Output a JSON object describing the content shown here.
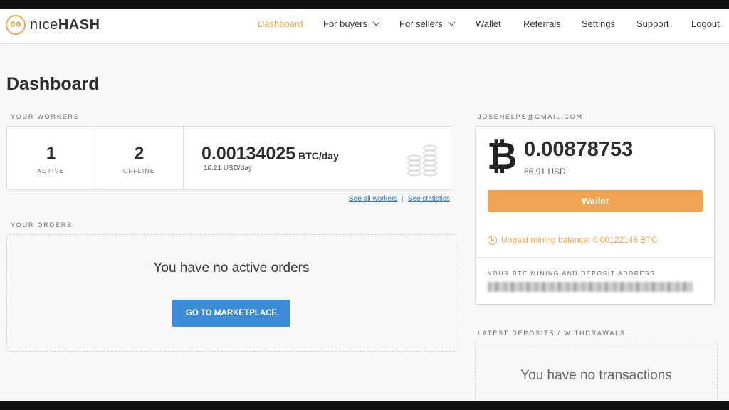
{
  "brand": {
    "name_light": "nıce",
    "name_bold": "HASH"
  },
  "nav": {
    "dashboard": "Dashboard",
    "for_buyers": "For buyers",
    "for_sellers": "For sellers",
    "wallet": "Wallet",
    "referrals": "Referrals",
    "settings": "Settings",
    "support": "Support",
    "logout": "Logout"
  },
  "page_title": "Dashboard",
  "workers": {
    "section_label": "YOUR WORKERS",
    "active_count": "1",
    "active_label": "ACTIVE",
    "offline_count": "2",
    "offline_label": "OFFLINE",
    "rate_value": "0.00134025",
    "rate_unit": "BTC/day",
    "rate_usd": "10.21 USD/day",
    "see_all_workers": "See all workers",
    "separator": "|",
    "see_statistics": "See statistics"
  },
  "orders": {
    "section_label": "YOUR ORDERS",
    "empty_text": "You have no active orders",
    "marketplace_button": "GO TO MARKETPLACE"
  },
  "account": {
    "email": "JOSEHELPS@GMAIL.COM",
    "btc_symbol": "₿",
    "balance": "0.00878753",
    "balance_usd": "66.91 USD",
    "wallet_button": "Wallet",
    "unpaid_text": "Unpaid mining balance: 0.00122145 BTC",
    "address_label": "YOUR BTC MINING AND DEPOSIT ADDRESS"
  },
  "transactions": {
    "section_label": "LATEST DEPOSITS / WITHDRAWALS",
    "empty_text": "You have no transactions"
  },
  "colors": {
    "accent_orange": "#f0a451",
    "primary_blue": "#3b8dd7",
    "link_blue": "#2b78c6"
  }
}
